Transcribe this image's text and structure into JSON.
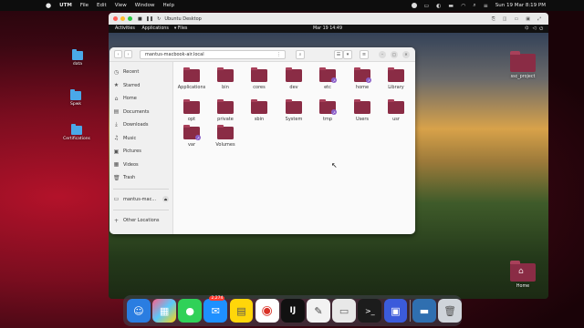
{
  "host_menubar": {
    "apple": "",
    "app": "UTM",
    "menus": [
      "File",
      "Edit",
      "View",
      "Window",
      "Help"
    ],
    "datetime": "Sun 19 Mar  8:19 PM"
  },
  "host_desktop": [
    {
      "label": "data"
    },
    {
      "label": "Spwk"
    },
    {
      "label": "Certifications"
    }
  ],
  "vm_window": {
    "title": "Ubuntu Desktop"
  },
  "gnome": {
    "activities": "Activities",
    "applications": "Applications",
    "files_menu": "Files",
    "clock": "Mar 19  14:49"
  },
  "guest_desktop": [
    {
      "label": "ssc_project"
    },
    {
      "label": "Home"
    }
  ],
  "files": {
    "path": "mantus-macbook-air.local",
    "sidebar": {
      "items": [
        {
          "icon": "clock-icon",
          "glyph": "◷",
          "label": "Recent"
        },
        {
          "icon": "star-icon",
          "glyph": "★",
          "label": "Starred"
        },
        {
          "icon": "home-icon",
          "glyph": "⌂",
          "label": "Home"
        },
        {
          "icon": "document-icon",
          "glyph": "▤",
          "label": "Documents"
        },
        {
          "icon": "download-icon",
          "glyph": "⤓",
          "label": "Downloads"
        },
        {
          "icon": "music-icon",
          "glyph": "♫",
          "label": "Music"
        },
        {
          "icon": "picture-icon",
          "glyph": "▣",
          "label": "Pictures"
        },
        {
          "icon": "video-icon",
          "glyph": "▦",
          "label": "Videos"
        },
        {
          "icon": "trash-icon",
          "glyph": "🗑",
          "label": "Trash"
        }
      ],
      "network_item": "mantus-mac...",
      "other_locations": "Other Locations"
    },
    "folders": [
      {
        "name": "Applications",
        "link": false
      },
      {
        "name": "bin",
        "link": false
      },
      {
        "name": "cores",
        "link": false
      },
      {
        "name": "dev",
        "link": false
      },
      {
        "name": "etc",
        "link": true
      },
      {
        "name": "home",
        "link": true
      },
      {
        "name": "Library",
        "link": false
      },
      {
        "name": "opt",
        "link": false
      },
      {
        "name": "private",
        "link": false
      },
      {
        "name": "sbin",
        "link": false
      },
      {
        "name": "System",
        "link": false
      },
      {
        "name": "tmp",
        "link": true
      },
      {
        "name": "Users",
        "link": false
      },
      {
        "name": "usr",
        "link": false
      },
      {
        "name": "var",
        "link": true
      },
      {
        "name": "Volumes",
        "link": false
      }
    ]
  },
  "dock": {
    "mail_badge": "2,274"
  }
}
